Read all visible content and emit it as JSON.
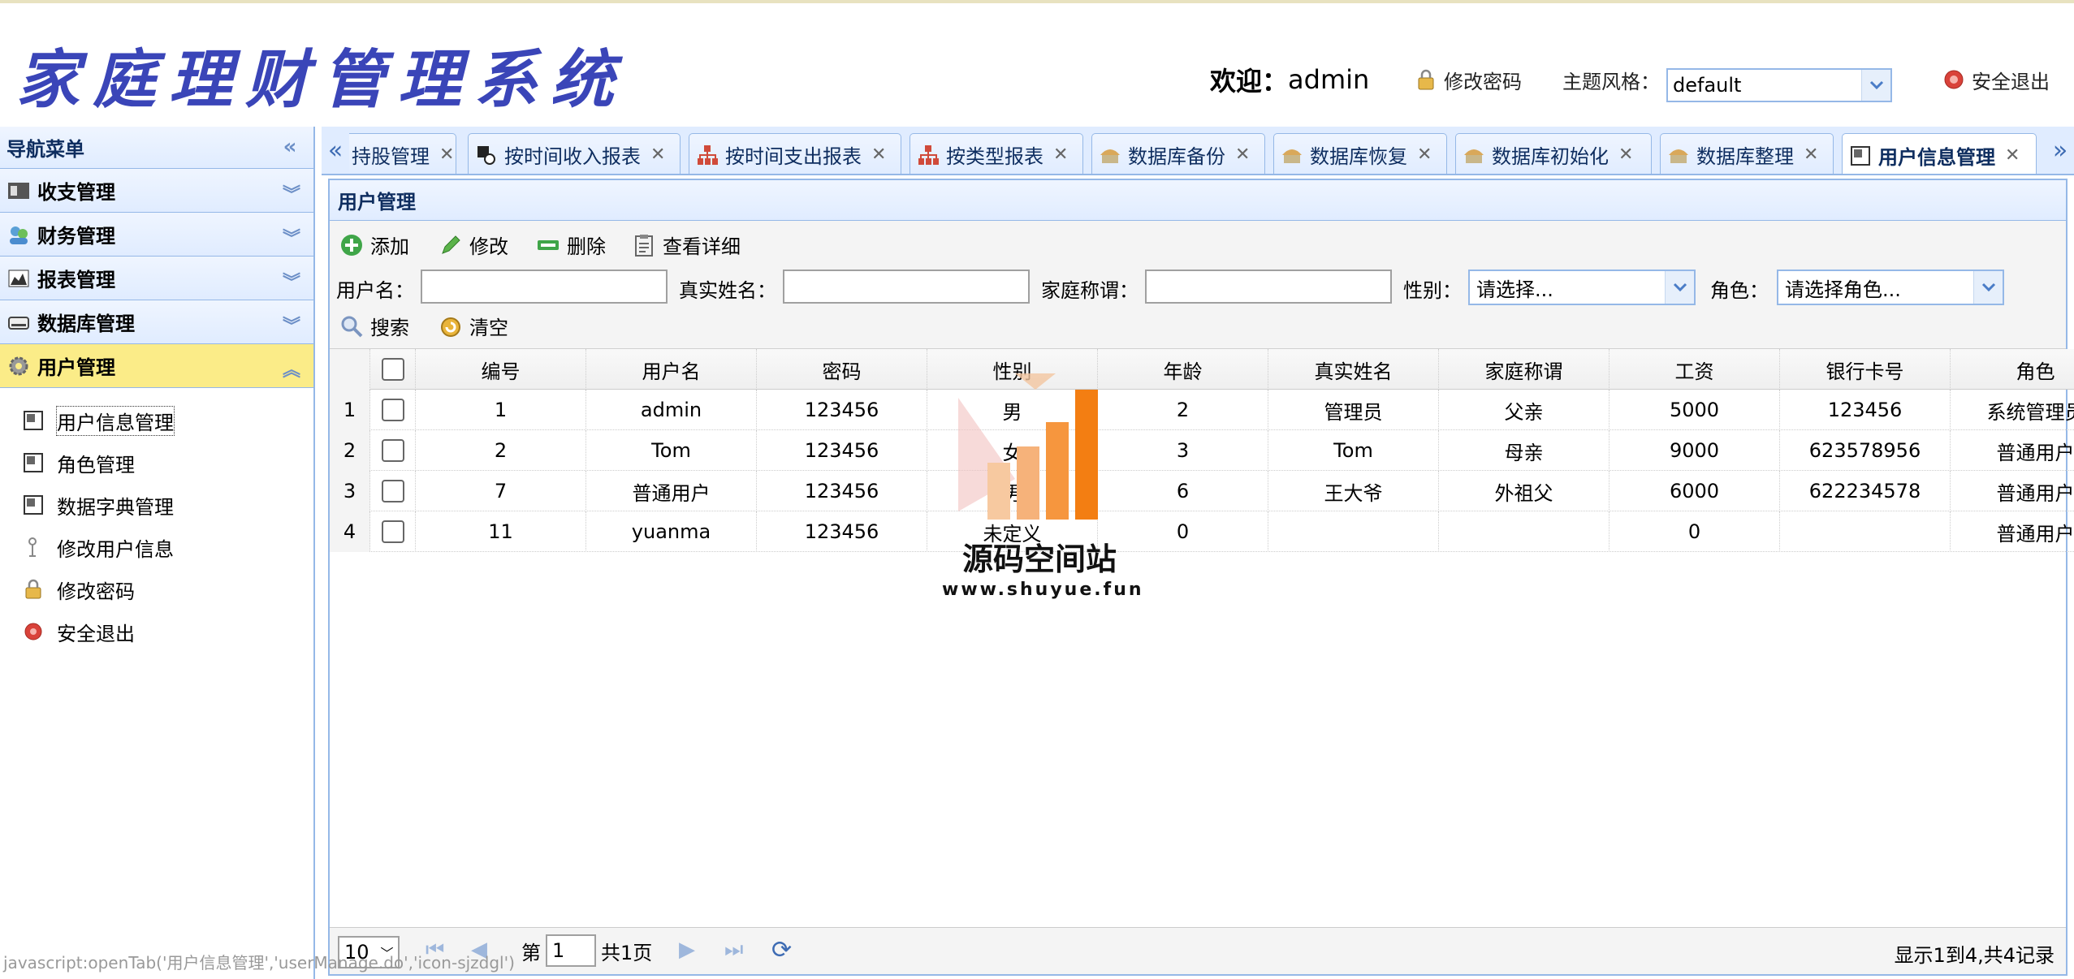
{
  "header": {
    "logo": "家庭理财管理系统",
    "welcome_label": "欢迎：",
    "welcome_user": "admin",
    "change_password": "修改密码",
    "theme_label": "主题风格：",
    "theme_value": "default",
    "logout": "安全退出"
  },
  "nav": {
    "title": "导航菜单",
    "sections": [
      {
        "label": "收支管理",
        "icon": "money-icon"
      },
      {
        "label": "财务管理",
        "icon": "users-icon"
      },
      {
        "label": "报表管理",
        "icon": "chart-icon"
      },
      {
        "label": "数据库管理",
        "icon": "database-icon"
      },
      {
        "label": "用户管理",
        "icon": "gear-icon"
      }
    ],
    "items": [
      {
        "label": "用户信息管理",
        "icon": "user-info-icon"
      },
      {
        "label": "角色管理",
        "icon": "role-icon"
      },
      {
        "label": "数据字典管理",
        "icon": "dictionary-icon"
      },
      {
        "label": "修改用户信息",
        "icon": "edit-user-icon"
      },
      {
        "label": "修改密码",
        "icon": "lock-icon"
      },
      {
        "label": "安全退出",
        "icon": "exit-icon"
      }
    ]
  },
  "tabs": [
    {
      "label": "持股管理"
    },
    {
      "label": "按时间收入报表"
    },
    {
      "label": "按时间支出报表"
    },
    {
      "label": "按类型报表"
    },
    {
      "label": "数据库备份"
    },
    {
      "label": "数据库恢复"
    },
    {
      "label": "数据库初始化"
    },
    {
      "label": "数据库整理"
    },
    {
      "label": "用户信息管理"
    }
  ],
  "panel": {
    "title": "用户管理",
    "toolbar": {
      "add": "添加",
      "edit": "修改",
      "delete": "删除",
      "detail": "查看详细",
      "search": "搜索",
      "clear": "清空"
    },
    "query": {
      "username_label": "用户名：",
      "realname_label": "真实姓名：",
      "family_label": "家庭称谓：",
      "gender_label": "性别：",
      "gender_placeholder": "请选择...",
      "role_label": "角色：",
      "role_placeholder": "请选择角色..."
    }
  },
  "grid": {
    "columns": [
      "编号",
      "用户名",
      "密码",
      "性别",
      "年龄",
      "真实姓名",
      "家庭称谓",
      "工资",
      "银行卡号",
      "角色"
    ],
    "rows": [
      [
        "1",
        "admin",
        "123456",
        "男",
        "2",
        "管理员",
        "父亲",
        "5000",
        "123456",
        "系统管理员"
      ],
      [
        "2",
        "Tom",
        "123456",
        "女",
        "3",
        "Tom",
        "母亲",
        "9000",
        "623578956",
        "普通用户"
      ],
      [
        "7",
        "普通用户",
        "123456",
        "男",
        "6",
        "王大爷",
        "外祖父",
        "6000",
        "622234578",
        "普通用户"
      ],
      [
        "11",
        "yuanma",
        "123456",
        "未定义",
        "0",
        "",
        "",
        "0",
        "",
        "普通用户"
      ]
    ]
  },
  "pager": {
    "page_size": "10",
    "page_prefix": "第",
    "page_current": "1",
    "page_total": "共1页",
    "summary": "显示1到4,共4记录"
  },
  "status_line": "javascript:openTab('用户信息管理','userManage.do','icon-sjzdgl')",
  "watermark": {
    "text": "源码空间站",
    "url": "www.shuyue.fun"
  },
  "colors": {
    "accent": "#95b8e7",
    "selected_section": "#fbec88",
    "logo": "#3a45b8"
  }
}
